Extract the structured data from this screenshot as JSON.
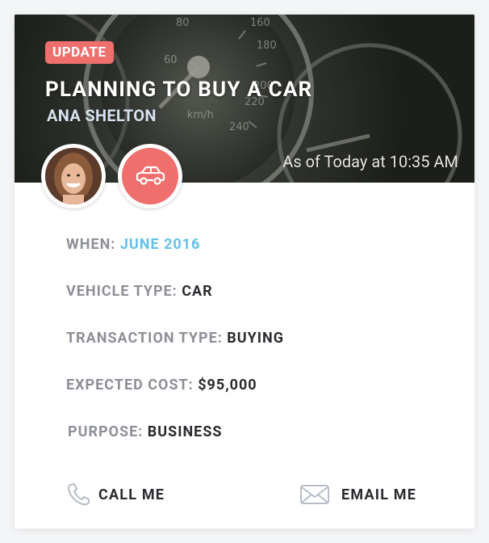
{
  "card": {
    "badge": "UPDATE",
    "title": "PLANNING TO BUY A CAR",
    "person_name": "ANA SHELTON",
    "timestamp": "As of Today at 10:35 AM",
    "icons": {
      "avatar": "user-photo",
      "car": "car-icon",
      "phone": "phone-icon",
      "email": "envelope-icon"
    },
    "colors": {
      "accent": "#ef6f6c",
      "highlight": "#63c2ea",
      "label": "#8d8f96",
      "value": "#2a2b2f"
    }
  },
  "details": {
    "when": {
      "label": "WHEN:",
      "value": "JUNE 2016"
    },
    "vehicle_type": {
      "label": "VEHICLE TYPE:",
      "value": "CAR"
    },
    "transaction_type": {
      "label": "TRANSACTION TYPE:",
      "value": "BUYING"
    },
    "expected_cost": {
      "label": "EXPECTED COST:",
      "value": "$95,000"
    },
    "purpose": {
      "label": "PURPOSE:",
      "value": "BUSINESS"
    }
  },
  "actions": {
    "call": "CALL ME",
    "email": "EMAIL ME"
  }
}
